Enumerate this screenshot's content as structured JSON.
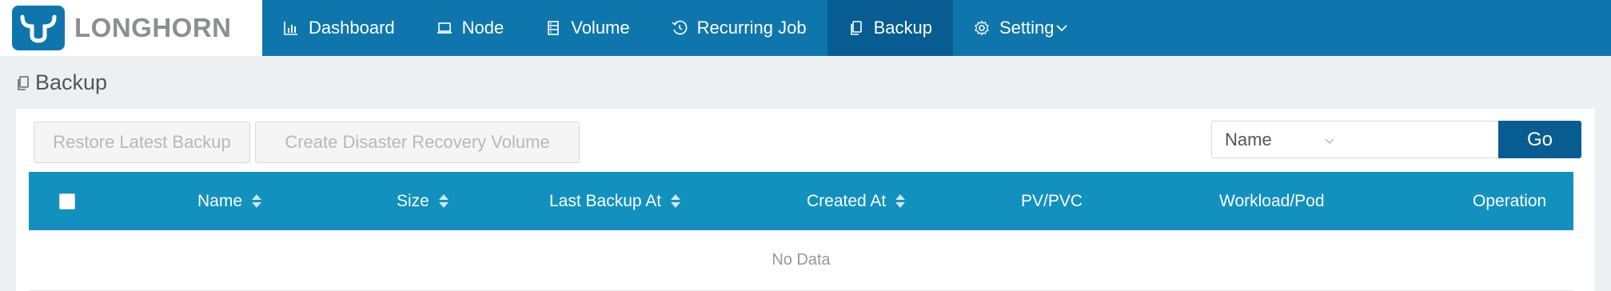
{
  "header": {
    "logo_text": "LONGHORN",
    "nav": [
      {
        "label": "Dashboard",
        "icon": "bar-chart-icon"
      },
      {
        "label": "Node",
        "icon": "laptop-icon"
      },
      {
        "label": "Volume",
        "icon": "database-icon"
      },
      {
        "label": "Recurring Job",
        "icon": "history-icon"
      },
      {
        "label": "Backup",
        "icon": "copy-icon",
        "active": true
      },
      {
        "label": "Setting",
        "icon": "gear-icon",
        "dropdown": true
      }
    ]
  },
  "page": {
    "title": "Backup",
    "title_icon": "copy-icon"
  },
  "toolbar": {
    "restore_label": "Restore Latest Backup",
    "create_dr_label": "Create Disaster Recovery Volume"
  },
  "search": {
    "field_selected": "Name",
    "value": "",
    "go_label": "Go"
  },
  "table": {
    "columns": [
      "Name",
      "Size",
      "Last Backup At",
      "Created At",
      "PV/PVC",
      "Workload/Pod",
      "Operation"
    ],
    "empty_text": "No Data"
  },
  "colors": {
    "header_bg": "#0f76ad",
    "active_nav": "#075d92",
    "table_header": "#1291bf",
    "go_button": "#075d92"
  }
}
